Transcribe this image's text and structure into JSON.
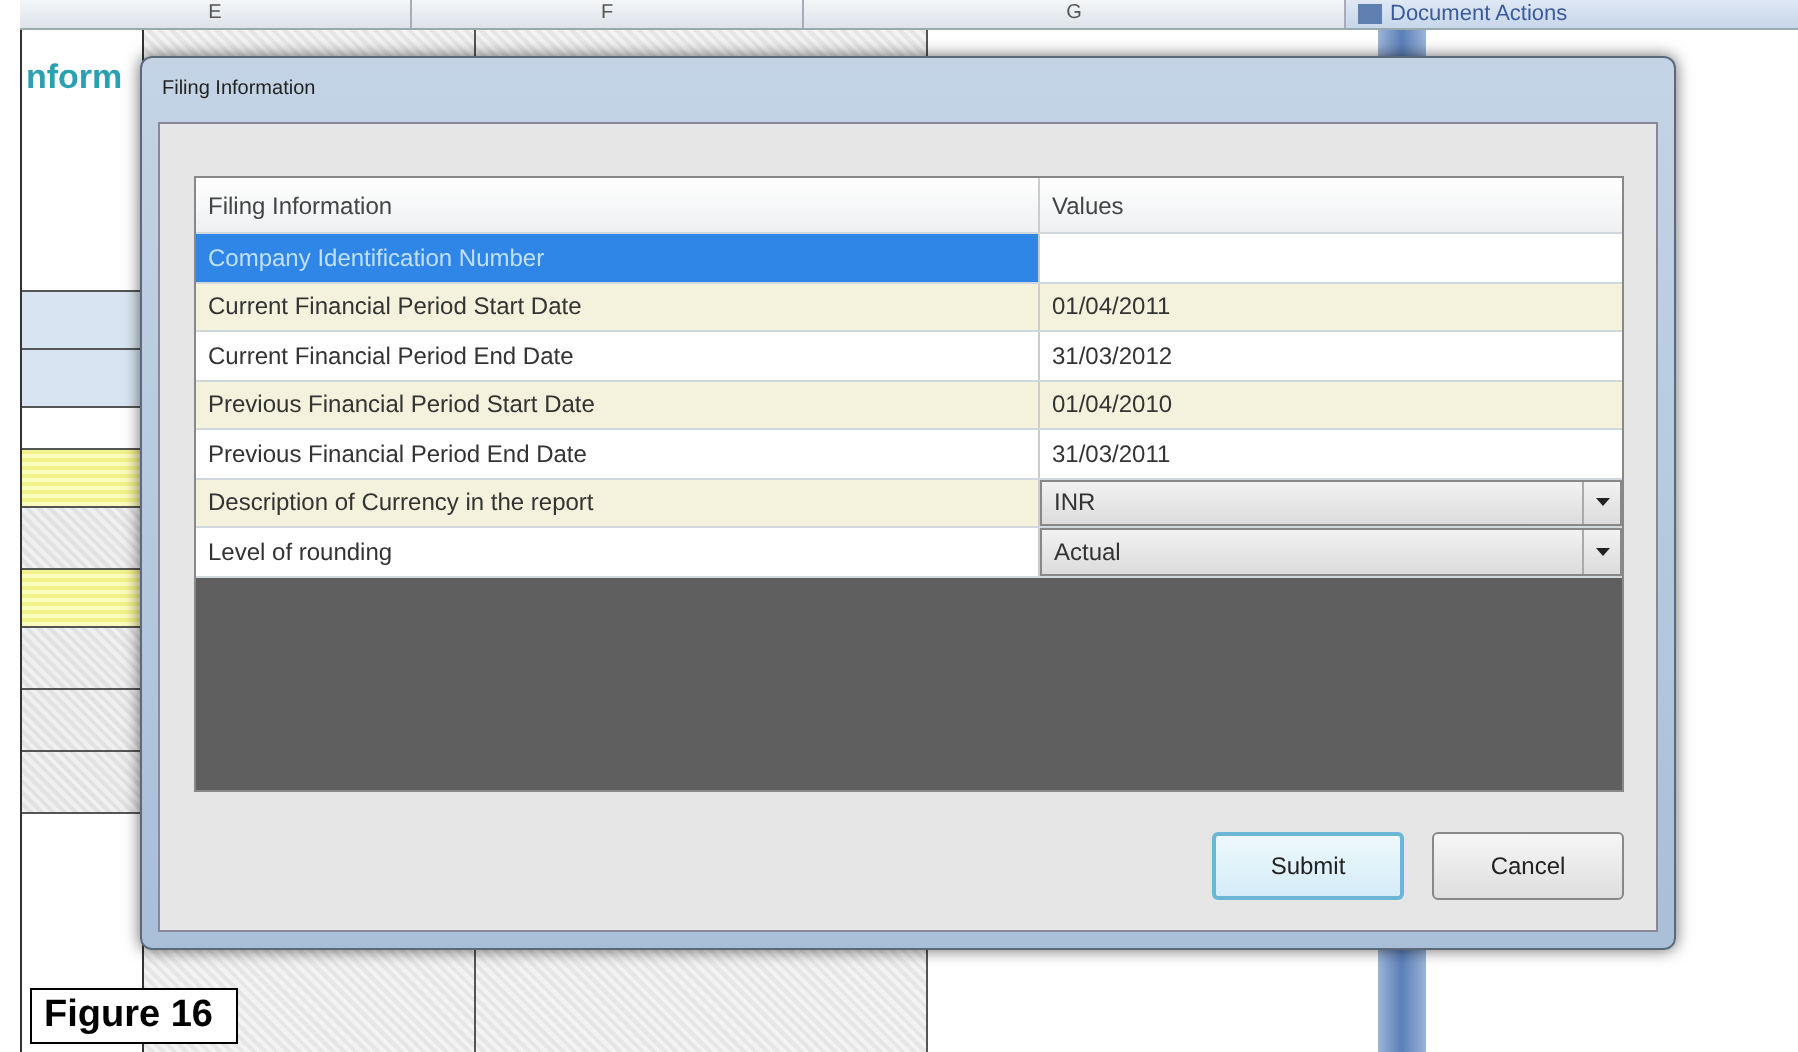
{
  "spreadsheet": {
    "columns": [
      "E",
      "F",
      "G"
    ],
    "cell_text": "nform",
    "pane_title": "Document Actions"
  },
  "dialog": {
    "title": "Filing Information",
    "table": {
      "columns": [
        "Filing Information",
        "Values"
      ],
      "rows": [
        {
          "label": "Company Identification Number",
          "kind": "text",
          "selected": true
        },
        {
          "label": "Current Financial Period Start Date",
          "value": "01/04/2011",
          "kind": "text",
          "selected": false
        },
        {
          "label": "Current Financial Period End Date",
          "value": "31/03/2012",
          "kind": "text",
          "selected": false
        },
        {
          "label": "Previous Financial Period Start Date",
          "value": "01/04/2010",
          "kind": "text",
          "selected": false
        },
        {
          "label": "Previous Financial Period End Date",
          "value": "31/03/2011",
          "kind": "text",
          "selected": false
        },
        {
          "label": "Description of Currency in the report",
          "value": "INR",
          "kind": "dropdown",
          "selected": false
        },
        {
          "label": "Level of rounding",
          "value": "Actual",
          "kind": "dropdown",
          "selected": false
        }
      ]
    },
    "buttons": [
      {
        "label": "Submit",
        "default": true
      },
      {
        "label": "Cancel",
        "default": false
      }
    ]
  },
  "caption": "Figure 16"
}
